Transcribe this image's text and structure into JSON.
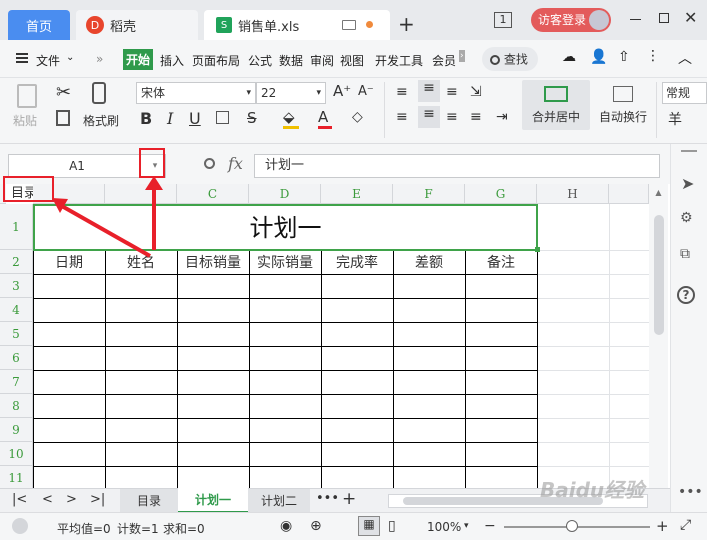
{
  "tabs": {
    "home": "首页",
    "daoke": "稻壳",
    "file": "销售单.xls",
    "new_tab": "+"
  },
  "window": {
    "badge": "1",
    "login": "访客登录"
  },
  "menu": {
    "file": "文件",
    "items": [
      "开始",
      "插入",
      "页面布局",
      "公式",
      "数据",
      "审阅",
      "视图",
      "开发工具",
      "会员"
    ],
    "search": "查找"
  },
  "ribbon": {
    "paste": "粘贴",
    "format_painter": "格式刷",
    "font_name": "宋体",
    "font_size": "22",
    "merge_center": "合并居中",
    "auto_wrap": "自动换行",
    "number_format": "常规",
    "currency": "羊"
  },
  "formula_bar": {
    "cell_ref": "A1",
    "fx": "fx",
    "content": "计划一"
  },
  "name_box_dropdown": "目录",
  "columns": [
    "C",
    "D",
    "E",
    "F",
    "G",
    "H"
  ],
  "rows": [
    "1",
    "2",
    "3",
    "4",
    "5",
    "6",
    "7",
    "8",
    "9",
    "10",
    "11"
  ],
  "sheet": {
    "title": "计划一",
    "headers": [
      "日期",
      "姓名",
      "目标销量",
      "实际销量",
      "完成率",
      "差额",
      "备注"
    ]
  },
  "sheet_tabs": [
    "目录",
    "计划一",
    "计划二"
  ],
  "status": {
    "average": "平均值=0",
    "count": "计数=1",
    "sum": "求和=0",
    "zoom": "100%"
  },
  "watermark": "Baidu经验"
}
